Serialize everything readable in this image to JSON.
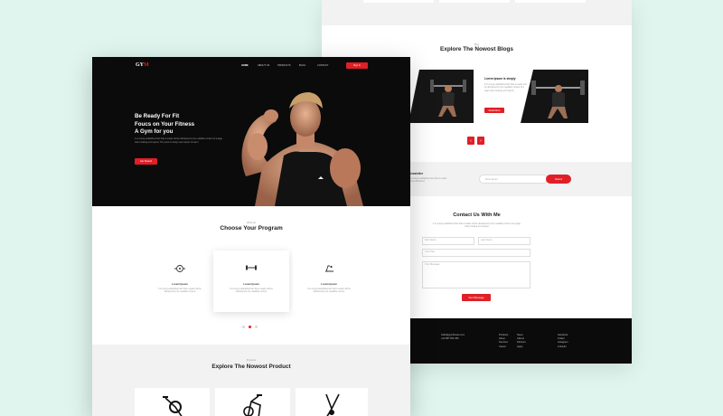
{
  "brand": {
    "logo_a": "GY",
    "logo_b": "M"
  },
  "nav": {
    "items": [
      "HOME",
      "ABOUT US",
      "PRODUCTS",
      "BLOG",
      "CONTACT"
    ],
    "signin": "Sign In"
  },
  "hero": {
    "line1": "Be Ready For Fit",
    "line2": "Foucs on Your Fitness",
    "line3": "A Gym for you",
    "body": "It is a long established fact that a reader will be distracted by the readable content of a page when looking at its layout. The point of using Lorem Ipsum is that it",
    "button": "Get Started"
  },
  "program": {
    "kicker": "What we",
    "title": "Choose Your Program",
    "cards": [
      {
        "title": "Lorem Ipsum",
        "text": "It is a long established fact that a reader will be distracted by the readable content",
        "icon": "weight-plate-icon"
      },
      {
        "title": "Lorem Ipsum",
        "text": "It is a long established fact that a reader will be distracted by the readable content",
        "icon": "dumbbell-icon"
      },
      {
        "title": "Lorem Ipsum",
        "text": "It is a long established fact that a reader will be distracted by the readable content",
        "icon": "treadmill-icon"
      }
    ]
  },
  "product": {
    "kicker": "Products",
    "title": "Explore The Nowost Product"
  },
  "blogs": {
    "kicker": "Blog",
    "title": "Explore The Nowost Blogs",
    "post_title": "Lorem Ipsum is simply",
    "post_text": "It is a long established fact that a reader will be distracted by the readable content of a page when looking at its layout",
    "read_more": "Read More"
  },
  "newsletter": {
    "title": "Newsletter",
    "text": "It is a long established fact that a reader will be distracted",
    "placeholder": "Enter Email",
    "button": "Submit"
  },
  "contact": {
    "title": "Contact Us With Me",
    "text": "It is a long established fact that a reader will be distracted by the readable content of a page when looking at its layout",
    "first_name": "First Name",
    "last_name": "Last Name",
    "your_title": "Your Title",
    "message": "Your Message",
    "button": "Send Message"
  },
  "footer": {
    "email": "hello@gymfitness.com",
    "phone": "+00 987 654 456",
    "col1": [
      "Products",
      "About",
      "Services",
      "Career"
    ],
    "col2": [
      "News",
      "Clients",
      "Partners",
      "Apply"
    ],
    "col3": [
      "Facebook",
      "Twitter",
      "Instagram",
      "Linkedin"
    ]
  },
  "colors": {
    "accent": "#e01f26",
    "dark": "#0b0b0b",
    "page_bg": "#dff5ee"
  }
}
